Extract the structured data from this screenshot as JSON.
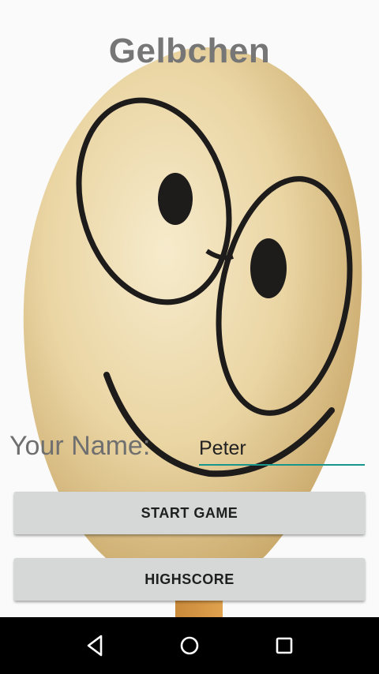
{
  "app": {
    "title": "Gelbchen"
  },
  "form": {
    "name_label": "Your Name:",
    "name_value": "Peter"
  },
  "buttons": {
    "start_label": "START GAME",
    "highscore_label": "HIGHSCORE"
  },
  "nav": {
    "back_icon": "back-triangle-icon",
    "home_icon": "home-circle-icon",
    "recent_icon": "recents-square-icon"
  },
  "colors": {
    "accent": "#19968c",
    "title": "#767676",
    "button_bg": "#d6d7d7",
    "plush": "#e8d2a0"
  }
}
